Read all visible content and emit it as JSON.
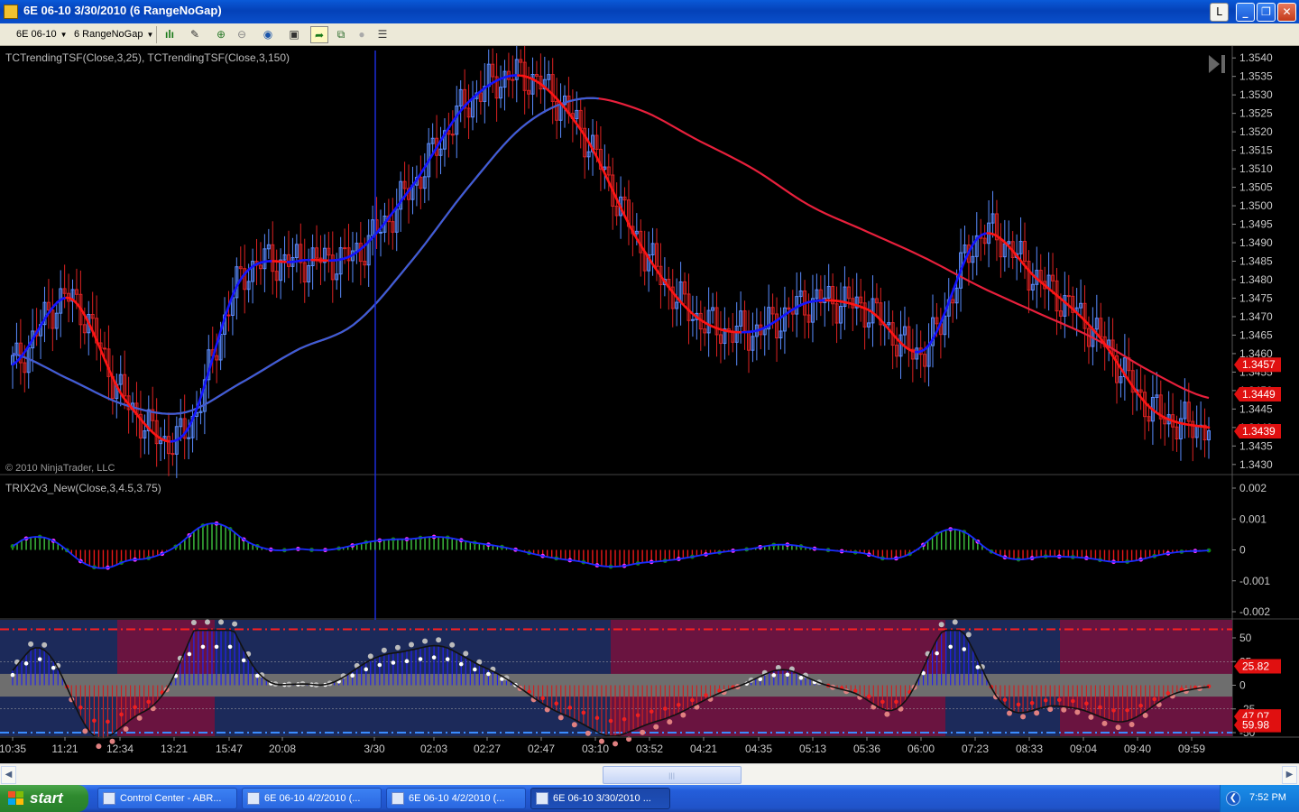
{
  "window": {
    "title": "6E 06-10  3/30/2010 (6 RangeNoGap)",
    "lock_label": "L",
    "min_label": "_",
    "max_label": "❐",
    "close_label": "✕"
  },
  "toolbar": {
    "instrument": "6E 06-10",
    "period": "6 RangeNoGap"
  },
  "price_panel": {
    "label": "TCTrendingTSF(Close,3,25),  TCTrendingTSF(Close,3,150)",
    "copyright": "© 2010 NinjaTrader, LLC",
    "y_ticks": [
      "1.3540",
      "1.3535",
      "1.3530",
      "1.3525",
      "1.3520",
      "1.3515",
      "1.3510",
      "1.3505",
      "1.3500",
      "1.3495",
      "1.3490",
      "1.3485",
      "1.3480",
      "1.3475",
      "1.3470",
      "1.3465",
      "1.3460",
      "1.3455",
      "1.3450",
      "1.3445",
      "1.3440",
      "1.3435",
      "1.3430"
    ],
    "price_flags": [
      "1.3457",
      "1.3449",
      "1.3439"
    ]
  },
  "trix_panel": {
    "label": "TRIX2v3_New(Close,3,4.5,3.75)",
    "y_ticks": [
      "0.002",
      "0.001",
      "0",
      "-0.001",
      "-0.002"
    ]
  },
  "osc_panel": {
    "y_ticks": [
      "50",
      "25",
      "0",
      "-25",
      "-50"
    ],
    "flags": [
      "25.82",
      "47.07",
      "59.98"
    ]
  },
  "x_axis": [
    "10:35",
    "11:21",
    "12:34",
    "13:21",
    "15:47",
    "20:08",
    "3/30",
    "02:03",
    "02:27",
    "02:47",
    "03:10",
    "03:52",
    "04:21",
    "04:35",
    "05:13",
    "05:36",
    "06:00",
    "07:23",
    "08:33",
    "09:04",
    "09:40",
    "09:59"
  ],
  "chart_data": {
    "type": "line",
    "title": "",
    "x": [
      "10:35",
      "11:21",
      "12:34",
      "13:21",
      "15:47",
      "20:08",
      "3/30",
      "02:03",
      "02:27",
      "02:47",
      "03:10",
      "03:52",
      "04:21",
      "04:35",
      "05:13",
      "05:36",
      "06:00",
      "07:23",
      "08:33",
      "09:04",
      "09:40",
      "09:59"
    ],
    "series": [
      {
        "name": "TCTrendingTSF(Close,3,25)",
        "values": [
          1.3457,
          1.3475,
          1.3447,
          1.3438,
          1.348,
          1.3485,
          1.3487,
          1.3505,
          1.3528,
          1.3535,
          1.352,
          1.349,
          1.347,
          1.3466,
          1.3474,
          1.3472,
          1.3461,
          1.3492,
          1.348,
          1.3466,
          1.3445,
          1.344
        ]
      },
      {
        "name": "TCTrendingTSF(Close,3,150)",
        "values": [
          1.346,
          1.3453,
          1.3446,
          1.3444,
          1.3452,
          1.3461,
          1.3468,
          1.3485,
          1.3505,
          1.3522,
          1.3529,
          1.3526,
          1.3518,
          1.351,
          1.35,
          1.3493,
          1.3486,
          1.3478,
          1.3471,
          1.3464,
          1.3455,
          1.3448
        ]
      }
    ],
    "ylim": [
      1.3428,
      1.3542
    ],
    "colors": {
      "up_trend": "#1414ff",
      "down_trend": "#ff1414",
      "long_tsf": "#3a5fd8",
      "up_bar": "#5a8cff",
      "down_bar": "#dd2222"
    }
  }
}
